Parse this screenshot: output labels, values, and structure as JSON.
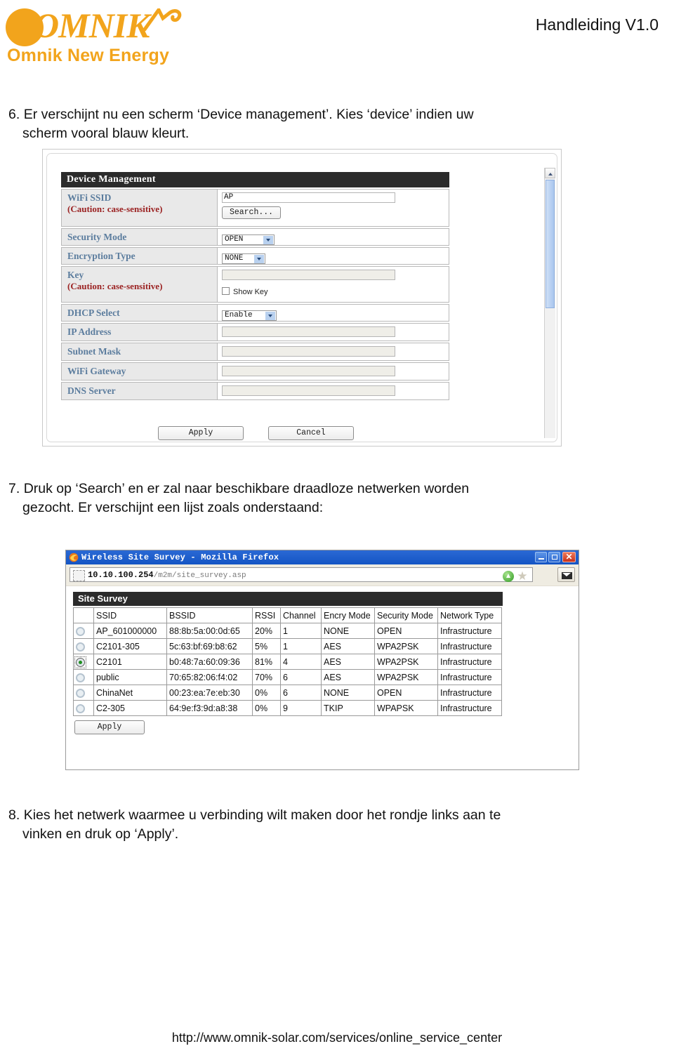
{
  "header": {
    "logo_word": "OMNIK",
    "logo_sub": "Omnik New Energy",
    "version": "Handleiding V1.0",
    "brand_color": "#F2A41C"
  },
  "steps": {
    "six": {
      "number": "6.",
      "line1": "Er verschijnt nu een scherm ‘Device management’. Kies ‘device’ indien uw",
      "line2": "scherm vooral blauw kleurt."
    },
    "seven": {
      "number": "7.",
      "line1": "Druk op ‘Search’ en er zal naar beschikbare draadloze netwerken worden",
      "line2": "gezocht. Er verschijnt een lijst zoals onderstaand:"
    },
    "eight": {
      "number": "8.",
      "line1": "Kies het netwerk waarmee u verbinding wilt maken door het rondje links aan te",
      "line2": "vinken en druk op ‘Apply’."
    }
  },
  "device_management": {
    "panel_title": "Device Management",
    "caution_text": "(Caution: case-sensitive)",
    "rows": [
      {
        "label": "WiFi SSID",
        "caution": true,
        "value": "AP",
        "search_label": "Search..."
      },
      {
        "label": "Security Mode",
        "caution": false,
        "select_value": "OPEN"
      },
      {
        "label": "Encryption Type",
        "caution": false,
        "select_value": "NONE"
      },
      {
        "label": "Key",
        "caution": true,
        "value": "",
        "checkbox_label": "Show Key"
      },
      {
        "label": "DHCP Select",
        "caution": false,
        "select_value": "Enable"
      },
      {
        "label": "IP Address",
        "caution": false,
        "value": ""
      },
      {
        "label": "Subnet Mask",
        "caution": false,
        "value": ""
      },
      {
        "label": "WiFi Gateway",
        "caution": false,
        "value": ""
      },
      {
        "label": "DNS Server",
        "caution": false,
        "value": ""
      }
    ],
    "apply_label": "Apply",
    "cancel_label": "Cancel"
  },
  "browser": {
    "window_title": "Wireless Site Survey - Mozilla Firefox",
    "url_host": "10.10.100.254",
    "url_path": "/m2m/site_survey.asp",
    "minimize_label": "_",
    "maximize_label": "□",
    "close_label": "✕"
  },
  "site_survey": {
    "panel_title": "Site Survey",
    "columns": [
      "",
      "SSID",
      "BSSID",
      "RSSI",
      "Channel",
      "Encry Mode",
      "Security Mode",
      "Network Type"
    ],
    "rows": [
      {
        "selected": false,
        "ssid": "AP_601000000",
        "bssid": "88:8b:5a:00:0d:65",
        "rssi": "20%",
        "channel": "1",
        "encry_mode": "NONE",
        "security_mode": "OPEN",
        "network_type": "Infrastructure"
      },
      {
        "selected": false,
        "ssid": "C2101-305",
        "bssid": "5c:63:bf:69:b8:62",
        "rssi": "5%",
        "channel": "1",
        "encry_mode": "AES",
        "security_mode": "WPA2PSK",
        "network_type": "Infrastructure"
      },
      {
        "selected": true,
        "ssid": "C2101",
        "bssid": "b0:48:7a:60:09:36",
        "rssi": "81%",
        "channel": "4",
        "encry_mode": "AES",
        "security_mode": "WPA2PSK",
        "network_type": "Infrastructure"
      },
      {
        "selected": false,
        "ssid": "public",
        "bssid": "70:65:82:06:f4:02",
        "rssi": "70%",
        "channel": "6",
        "encry_mode": "AES",
        "security_mode": "WPA2PSK",
        "network_type": "Infrastructure"
      },
      {
        "selected": false,
        "ssid": "ChinaNet",
        "bssid": "00:23:ea:7e:eb:30",
        "rssi": "0%",
        "channel": "6",
        "encry_mode": "NONE",
        "security_mode": "OPEN",
        "network_type": "Infrastructure"
      },
      {
        "selected": false,
        "ssid": "C2-305",
        "bssid": "64:9e:f3:9d:a8:38",
        "rssi": "0%",
        "channel": "9",
        "encry_mode": "TKIP",
        "security_mode": "WPAPSK",
        "network_type": "Infrastructure"
      }
    ],
    "apply_label": "Apply"
  },
  "footer": {
    "url": "http://www.omnik-solar.com/services/online_service_center"
  }
}
